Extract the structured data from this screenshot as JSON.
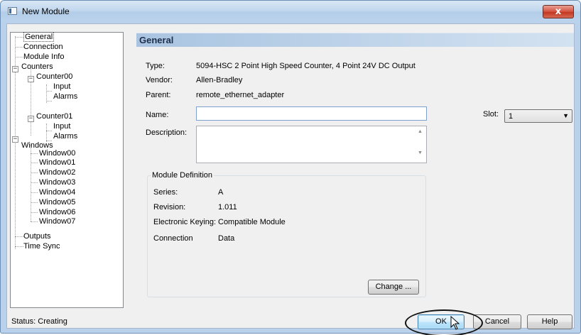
{
  "window": {
    "title": "New Module",
    "close_label": "x"
  },
  "tree": {
    "items": [
      {
        "label": "General"
      },
      {
        "label": "Connection"
      },
      {
        "label": "Module Info"
      },
      {
        "label": "Counters"
      },
      {
        "label": "Counter00"
      },
      {
        "label": "Input"
      },
      {
        "label": "Alarms"
      },
      {
        "label": "Counter01"
      },
      {
        "label": "Input"
      },
      {
        "label": "Alarms"
      },
      {
        "label": "Windows"
      },
      {
        "label": "Window00"
      },
      {
        "label": "Window01"
      },
      {
        "label": "Window02"
      },
      {
        "label": "Window03"
      },
      {
        "label": "Window04"
      },
      {
        "label": "Window05"
      },
      {
        "label": "Window06"
      },
      {
        "label": "Window07"
      },
      {
        "label": "Outputs"
      },
      {
        "label": "Time Sync"
      }
    ],
    "selected": "General",
    "expander_symbol": "−"
  },
  "panel": {
    "title": "General",
    "type_label": "Type:",
    "type_value": "5094-HSC   2 Point High Speed Counter, 4 Point 24V DC Output",
    "vendor_label": "Vendor:",
    "vendor_value": "Allen-Bradley",
    "parent_label": "Parent:",
    "parent_value": "remote_ethernet_adapter",
    "name_label": "Name:",
    "name_value": "",
    "description_label": "Description:",
    "description_value": "",
    "slot_label": "Slot:",
    "slot_value": "1"
  },
  "module_definition": {
    "title": "Module Definition",
    "series_label": "Series:",
    "series_value": "A",
    "revision_label": "Revision:",
    "revision_value": "1.011",
    "keying_label": "Electronic Keying:",
    "keying_value": "Compatible Module",
    "connection_label": "Connection",
    "connection_value": "Data",
    "change_button": "Change ..."
  },
  "footer": {
    "status": "Status:  Creating",
    "ok_button": "OK",
    "cancel_button": "Cancel",
    "help_button": "Help"
  }
}
